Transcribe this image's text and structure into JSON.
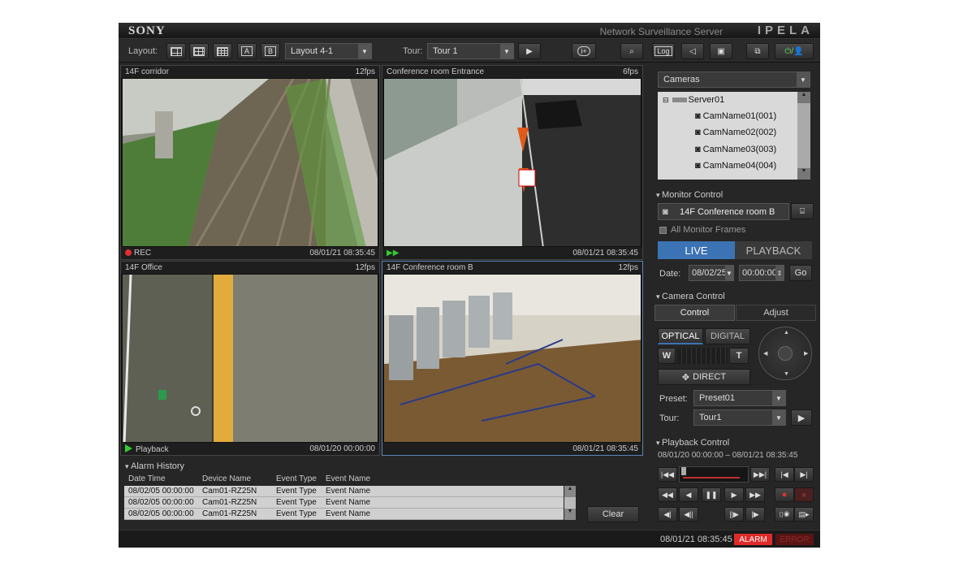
{
  "app": {
    "logo": "SONY",
    "product": "Network Surveillance Server",
    "brand": "IPELA"
  },
  "toolbar": {
    "layout_label": "Layout:",
    "layout_value": "Layout 4-1",
    "tour_label": "Tour:",
    "tour_value": "Tour 1",
    "a_label": "A",
    "b_label": "B",
    "info_label": "i+",
    "log_label": "Log"
  },
  "frames": [
    {
      "title": "14F corridor",
      "fps": "12fps",
      "status": "REC",
      "timestamp": "08/01/21 08:35:45"
    },
    {
      "title": "Conference room Entrance",
      "fps": "6fps",
      "status": "",
      "timestamp": "08/01/21 08:35:45"
    },
    {
      "title": "14F Office",
      "fps": "12fps",
      "status": "Playback",
      "timestamp": "08/01/20 00:00:00"
    },
    {
      "title": "14F Conference room B",
      "fps": "12fps",
      "status": "",
      "timestamp": "08/01/21 08:35:45"
    }
  ],
  "cameras": {
    "dropdown": "Cameras",
    "server": "Server01",
    "items": [
      "CamName01(001)",
      "CamName02(002)",
      "CamName03(003)",
      "CamName04(004)"
    ]
  },
  "monitor_control": {
    "header": "Monitor Control",
    "selected": "14F Conference room B",
    "all_frames": "All Monitor Frames",
    "live": "LIVE",
    "playback": "PLAYBACK",
    "date_label": "Date:",
    "date_value": "08/02/25",
    "time_value": "00:00:00",
    "go": "Go"
  },
  "camera_control": {
    "header": "Camera Control",
    "tab_control": "Control",
    "tab_adjust": "Adjust",
    "optical": "OPTICAL",
    "digital": "DIGITAL",
    "wide": "W",
    "tele": "T",
    "direct": "DIRECT",
    "preset_label": "Preset:",
    "preset_value": "Preset01",
    "tour_label": "Tour:",
    "tour_value": "Tour1"
  },
  "playback_control": {
    "header": "Playback Control",
    "range_start": "08/01/20 00:00:00",
    "range_sep": "–",
    "range_end": "08/01/21 08:35:45"
  },
  "alarm_history": {
    "header": "Alarm History",
    "columns": [
      "Date Time",
      "Device Name",
      "Event Type",
      "Event Name"
    ],
    "rows": [
      [
        "08/02/05 00:00:00",
        "Cam01-RZ25N",
        "Event Type",
        "Event Name"
      ],
      [
        "08/02/05 00:00:00",
        "Cam01-RZ25N",
        "Event Type",
        "Event Name"
      ],
      [
        "08/02/05 00:00:00",
        "Cam01-RZ25N",
        "Event Type",
        "Event Name"
      ]
    ],
    "clear": "Clear"
  },
  "status_bar": {
    "time": "08/01/21 08:35:45",
    "alarm": "ALARM",
    "error": "ERROR"
  },
  "colors": {
    "accent": "#3c73b4",
    "alarm": "#e02a2a",
    "error": "#7a1414",
    "rec": "#e03030",
    "play": "#33cc33"
  }
}
